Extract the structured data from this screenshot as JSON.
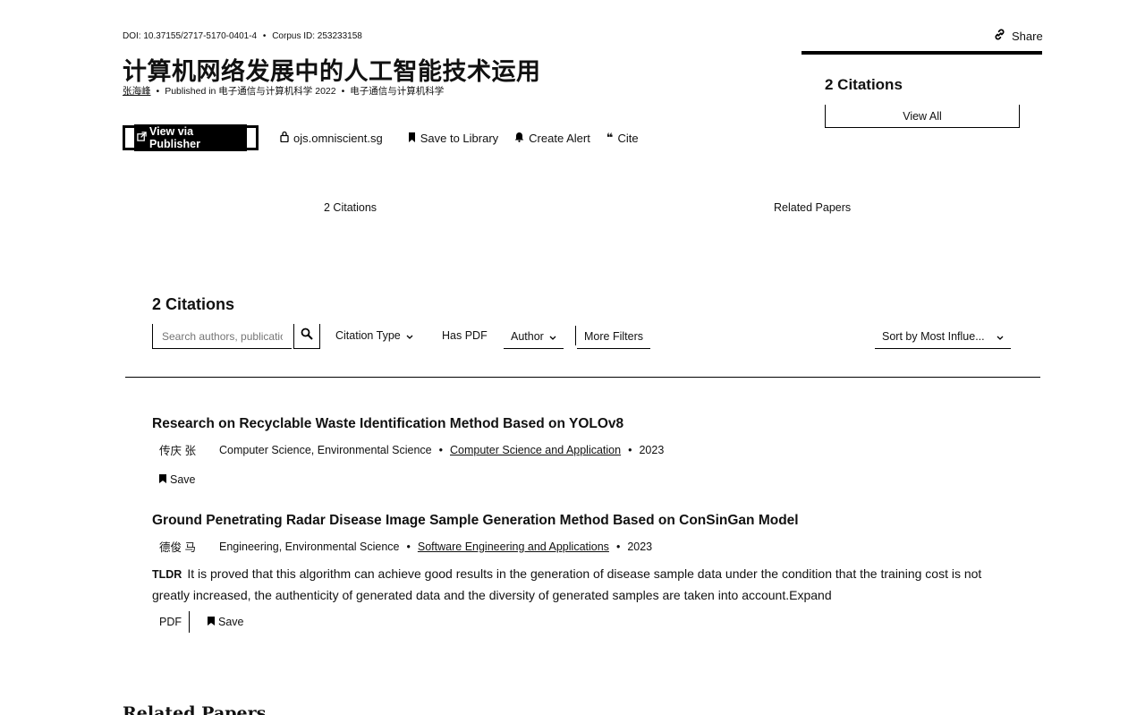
{
  "header": {
    "doi": "DOI: 10.37155/2717-5170-0401-4",
    "corpus_id": "Corpus ID: 253233158",
    "share_label": "Share",
    "title": "计算机网络发展中的人工智能技术运用",
    "author": "张海峰",
    "published_in": "Published in 电子通信与计算机科学 2022",
    "journal": "电子通信与计算机科学"
  },
  "actions": {
    "view_publisher": "View via Publisher",
    "source": "ojs.omniscient.sg",
    "save_library": "Save to Library",
    "create_alert": "Create Alert",
    "cite": "Cite"
  },
  "citations_card": {
    "heading": "2 Citations",
    "view_all": "View All"
  },
  "tabs": {
    "citations": "2 Citations",
    "related": "Related Papers"
  },
  "citations_section": {
    "heading": "2 Citations",
    "search_placeholder": "Search authors, publications",
    "filters": {
      "citation_type": "Citation Type",
      "has_pdf": "Has PDF",
      "author": "Author",
      "more_filters": "More Filters",
      "sort": "Sort by Most Influe..."
    }
  },
  "papers": [
    {
      "title": "Research on Recyclable Waste Identification Method Based on YOLOv8",
      "author": "传庆 张",
      "fields": "Computer Science, Environmental Science",
      "venue": "Computer Science and Application",
      "year": "2023",
      "save": "Save"
    },
    {
      "title": "Ground Penetrating Radar Disease Image Sample Generation Method Based on ConSinGan Model",
      "author": "德俊 马",
      "fields": "Engineering, Environmental Science",
      "venue": "Software Engineering and Applications",
      "year": "2023",
      "tldr_tag": "TLDR",
      "tldr": "It is proved that this algorithm can achieve good results in the generation of disease sample data under the condition that the training cost is not greatly increased, the authenticity of generated data and the diversity of generated samples are taken into account.",
      "expand": "Expand",
      "pdf": "PDF",
      "save": "Save"
    }
  ],
  "related_heading": "Related Papers",
  "separators": {
    "dot": "•"
  }
}
